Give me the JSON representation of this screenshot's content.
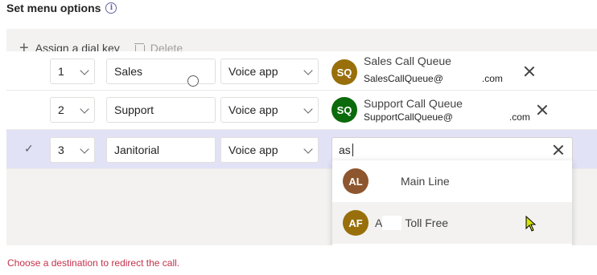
{
  "header": {
    "title": "Set menu options",
    "info_icon": "info-icon"
  },
  "toolbar": {
    "assign_label": "Assign a dial key",
    "delete_label": "Delete"
  },
  "rows": [
    {
      "key": "1",
      "name": "Sales",
      "type": "Voice app",
      "dest_initials": "SQ",
      "dest_name": "Sales Call Queue",
      "dest_email": "SalesCallQueue@",
      "dest_domain": ".com",
      "avatar_color": "#986f0b"
    },
    {
      "key": "2",
      "name": "Support",
      "type": "Voice app",
      "dest_initials": "SQ",
      "dest_name": "Support Call Queue",
      "dest_email": "SupportCallQueue@",
      "dest_domain": ".com",
      "avatar_color": "#0b6a0b"
    },
    {
      "key": "3",
      "name": "Janitorial",
      "type": "Voice app",
      "search_value": "as"
    }
  ],
  "suggestions": [
    {
      "initials": "AL",
      "label_prefix": "",
      "label": "Main Line",
      "avatar_color": "#8e562e"
    },
    {
      "initials": "AF",
      "label_prefix": "A",
      "label": "Toll Free",
      "avatar_color": "#986f0b"
    }
  ],
  "error_message": "Choose a destination to redirect the call."
}
